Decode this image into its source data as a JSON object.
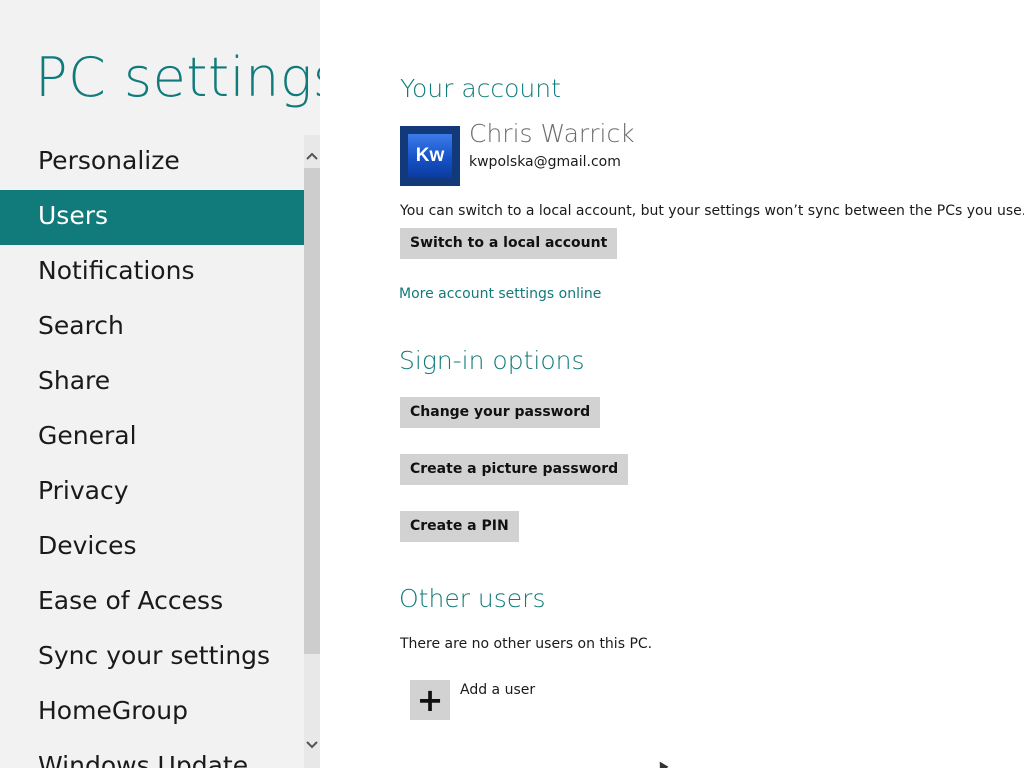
{
  "app": {
    "title": "PC settings"
  },
  "nav": {
    "items": [
      {
        "label": "Personalize"
      },
      {
        "label": "Users"
      },
      {
        "label": "Notifications"
      },
      {
        "label": "Search"
      },
      {
        "label": "Share"
      },
      {
        "label": "General"
      },
      {
        "label": "Privacy"
      },
      {
        "label": "Devices"
      },
      {
        "label": "Ease of Access"
      },
      {
        "label": "Sync your settings"
      },
      {
        "label": "HomeGroup"
      },
      {
        "label": "Windows Update"
      }
    ],
    "selected": "Users",
    "scroll_up_icon": "chevron-up-icon",
    "scroll_down_icon": "chevron-down-icon"
  },
  "account": {
    "heading": "Your account",
    "avatar_initials": "Kw",
    "name": "Chris Warrick",
    "email": "kwpolska@gmail.com",
    "notice": "You can switch to a local account, but your settings won’t sync between the PCs you use.",
    "switch_button": "Switch to a local account",
    "more_link": "More account settings online"
  },
  "signin": {
    "heading": "Sign-in options",
    "change_password": "Change your password",
    "picture_password": "Create a picture password",
    "create_pin": "Create a PIN"
  },
  "other_users": {
    "heading": "Other users",
    "notice": "There are no other users on this PC.",
    "add_icon_glyph": "+",
    "add_label": "Add a user"
  },
  "colors": {
    "accent": "#117a7a",
    "left_background": "#f2f2f2",
    "button": "#d2d2d2"
  }
}
